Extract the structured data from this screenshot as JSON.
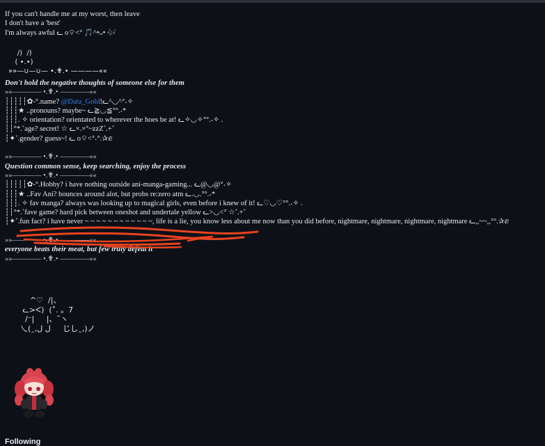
{
  "bio": {
    "intro": [
      "If you can't handle me at my worst, then leave",
      "I don't have a 'best'",
      "I'm always awful ᓚ o⌔<ᐣ 🎵^•ᴗ• 🎶"
    ],
    "art_top": "    /)  /)\n   ( •.•)\n»»—∪—∪— •.✟.• ————««",
    "quote1": "Don't hold the negative thoughts of someone else for them",
    "divider1": "»»———— •.✟.• ————««",
    "about": {
      "name_prefix": "┆┆┆┆┆✿-°.name? ",
      "name_mention": "@Data_Gold",
      "name_suffix": "!ᓚ^◡^ᐣ˖✧",
      "pronouns": "┆┆┆★ ..pronouns? maybe~ ᓚ≧◡≦ᐣ°.˖*",
      "orientation": "┆┆┆. ✧ orientation? orientated to wherever the hoes be at! ᓚ✧◡✧ᐣ°.˖✧ .",
      "age": "┆┆°*.˚age? secret! ☆ ᓚ×.×ᐣ~zzZ˚.+˚",
      "gender": "┆✦˚.gender? guess~! ᓚ o⌔<ᐣ˖°.✰ⅇ"
    },
    "divider2": "»»———— •.✟.• ————««",
    "quote2": "Question common sense, keep searching, enjoy the process",
    "divider3": "»»———— •.✟.• ————««",
    "hobbies": {
      "hobby": "┆┆┆┆┆✿-°.Hobby? i have nothing outside ani-manga-gaming... ᓚ@◡@ᐣ˖✧",
      "fav_ani": "┆┆┆★ ..Fav Ani? bounces around alot, but probs re:zero atm ᓚ.◡.ᐣ°.˖*",
      "fav_manga": "┆┆┆. ✧ fav manga? always was looking up to magical girls, even before i knew of it! ᓚ♡◡♡ᐣ°.˖✧ .",
      "fave_game": "┆┆°*.˚fave game? hard pick between oneshot and undertale yellow ᓚ>◡<ᐣ ☆˚.+˚",
      "fun_fact_struck": "┆✦˚.fun fact? i have never ~ ~ ~ ~ ~ ~ ~ ~ ~ ~ ~ ~, life is a lie,",
      "fun_fact_rest": " you know less about me now than you did before, nightmare, nightmare, nightmare, nightmare ᓚ,,~~,,ᐣ°.✰ⅇ"
    },
    "divider4": "»»———— •.✟.• ————««",
    "quote3": "everyone beats their meat, but few truly defeat it",
    "divider5": "»»———— •.✟.• ————««",
    "art_cat": "      ^♡  /|、\n   ᓚ>ᐸ)  (˚. 。7\n    /⁻|     |、˜ヽ\n  乀(ˍ,ل ل     じしˍ,)ノ"
  },
  "section": {
    "following_label": "Following"
  },
  "colors": {
    "background": "#0d1117",
    "text": "#e6edf3",
    "mention": "#2f81f7",
    "scribble": "#e8431f"
  }
}
